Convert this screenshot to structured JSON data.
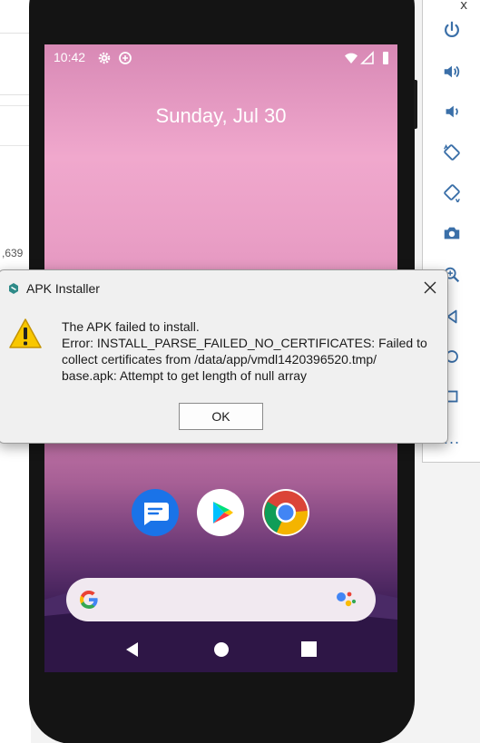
{
  "background_app": {
    "number_fragment": ",639"
  },
  "phone": {
    "status_bar": {
      "time": "10:42"
    },
    "lockscreen": {
      "date": "Sunday, Jul 30"
    },
    "dock_apps": [
      "messages-app",
      "play-store-app",
      "chrome-app"
    ],
    "search_bar": {
      "logo": "G"
    }
  },
  "dialog": {
    "title": "APK Installer",
    "message_lines": [
      "The APK failed to install.",
      "Error: INSTALL_PARSE_FAILED_NO_CERTIFICATES: Failed to",
      "collect certificates from /data/app/vmdl1420396520.tmp/",
      "base.apk: Attempt to get length of null array"
    ],
    "ok_label": "OK"
  },
  "emulator_toolbar": {
    "close_label": "x",
    "more_label": "..."
  },
  "colors": {
    "dialog_bg": "#f0f0f0",
    "warning": "#f8c700",
    "toolbar_icon": "#3a6fa8"
  }
}
